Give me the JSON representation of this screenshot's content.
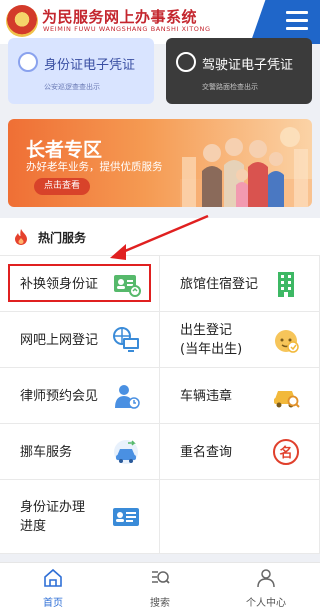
{
  "header": {
    "title": "为民服务网上办事系统",
    "subtitle": "WEIMIN FUWU WANGSHANG BANSHI XITONG"
  },
  "top_cards": [
    {
      "title": "身份证电子凭证",
      "subtitle": "公安巡逻查查出示",
      "color": "#d9e4ff"
    },
    {
      "title": "驾驶证电子凭证",
      "subtitle": "交警路面检查出示",
      "color": "#3b3b3b"
    }
  ],
  "banner": {
    "title": "长者专区",
    "subtitle": "办好老年业务，提供优质服务",
    "button": "点击查看"
  },
  "hot_services": {
    "title": "热门服务",
    "items": [
      {
        "label": "补换领身份证",
        "icon": "id-card-replace-icon",
        "color": "#56b96b"
      },
      {
        "label": "旅馆住宿登记",
        "icon": "hotel-building-icon",
        "color": "#3db864"
      },
      {
        "label": "网吧上网登记",
        "icon": "computer-globe-icon",
        "color": "#3a8bd8"
      },
      {
        "label": "出生登记\n(当年出生)",
        "icon": "baby-face-icon",
        "color": "#f2b93b"
      },
      {
        "label": "律师预约会见",
        "icon": "lawyer-clock-icon",
        "color": "#4a90e2"
      },
      {
        "label": "车辆违章",
        "icon": "car-search-icon",
        "color": "#f2b93b"
      },
      {
        "label": "挪车服务",
        "icon": "car-move-icon",
        "color": "#4a90e2"
      },
      {
        "label": "重名查询",
        "icon": "name-tag-icon",
        "color": "#e0402c"
      },
      {
        "label": "身份证办理\n进度",
        "icon": "id-card-progress-icon",
        "color": "#3a8bd8"
      }
    ]
  },
  "tabbar": [
    {
      "label": "首页",
      "icon": "home-icon",
      "active": true
    },
    {
      "label": "搜索",
      "icon": "search-icon",
      "active": false
    },
    {
      "label": "个人中心",
      "icon": "user-icon",
      "active": false
    }
  ],
  "colors": {
    "accent": "#1f66c9",
    "brand_red": "#c4262e",
    "highlight": "#e02020"
  }
}
